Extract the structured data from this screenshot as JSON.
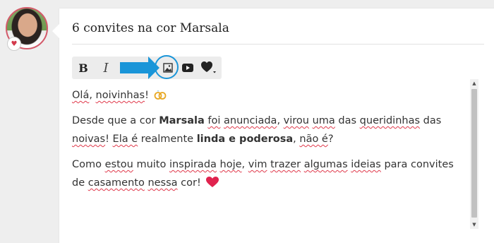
{
  "post": {
    "title": "6 convites na cor Marsala"
  },
  "toolbar": {
    "bold_label": "B",
    "italic_label": "I",
    "image_icon": "image-icon",
    "video_icon": "youtube-icon",
    "emoji_icon": "heart-icon"
  },
  "content": {
    "p1": {
      "t1": "Olá",
      "t2": ", ",
      "t3": "noivinhas",
      "t4": "!"
    },
    "p2": {
      "t1": "Desde que a cor ",
      "t2": "Marsala",
      "t3": " ",
      "t4": "foi",
      "t5": " ",
      "t6": "anunciada",
      "t7": ", ",
      "t8": "virou",
      "t9": " ",
      "t10": "uma",
      "t11": " das ",
      "t12": "queridinhas",
      "t13": " das ",
      "t14": "noivas",
      "t15": "! ",
      "t16": "Ela é",
      "t17": " realmente ",
      "t18": "linda e poderosa",
      "t19": ", ",
      "t20": "não é",
      "t21": "?"
    },
    "p3": {
      "t1": "Como ",
      "t2": "estou",
      "t3": " muito ",
      "t4": "inspirada",
      "t5": " ",
      "t6": "hoje",
      "t7": ", ",
      "t8": "vim",
      "t9": " ",
      "t10": "trazer",
      "t11": " ",
      "t12": "algumas",
      "t13": " ",
      "t14": "ideias",
      "t15": " para convites de ",
      "t16": "casamento",
      "t17": " ",
      "t18": "nessa",
      "t19": " cor!"
    }
  },
  "colors": {
    "accent_arrow": "#1a95d8",
    "heart": "#e0234e",
    "spellcheck": "#e0394b"
  }
}
